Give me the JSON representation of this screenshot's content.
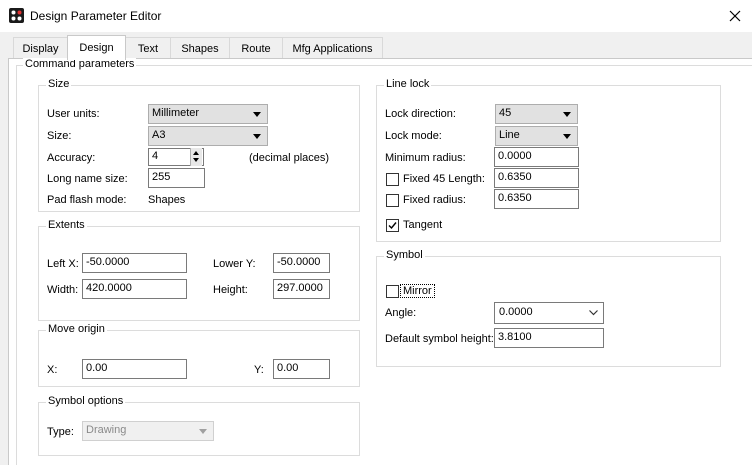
{
  "window": {
    "title": "Design Parameter Editor"
  },
  "tabs": [
    "Display",
    "Design",
    "Text",
    "Shapes",
    "Route",
    "Mfg Applications"
  ],
  "active_tab": "Design",
  "command_parameters": {
    "label": "Command parameters",
    "size": {
      "label": "Size",
      "user_units_label": "User units:",
      "user_units_value": "Millimeter",
      "size_label": "Size:",
      "size_value": "A3",
      "accuracy_label": "Accuracy:",
      "accuracy_value": "4",
      "accuracy_suffix": "(decimal places)",
      "long_name_label": "Long name size:",
      "long_name_value": "255",
      "pad_flash_label": "Pad flash mode:",
      "pad_flash_value": "Shapes"
    },
    "extents": {
      "label": "Extents",
      "left_x_label": "Left X:",
      "left_x_value": "-50.0000",
      "lower_y_label": "Lower Y:",
      "lower_y_value": "-50.0000",
      "width_label": "Width:",
      "width_value": "420.0000",
      "height_label": "Height:",
      "height_value": "297.0000"
    },
    "move_origin": {
      "label": "Move origin",
      "x_label": "X:",
      "x_value": "0.00",
      "y_label": "Y:",
      "y_value": "0.00"
    },
    "symbol_options": {
      "label": "Symbol options",
      "type_label": "Type:",
      "type_value": "Drawing"
    },
    "line_lock": {
      "label": "Line lock",
      "lock_direction_label": "Lock direction:",
      "lock_direction_value": "45",
      "lock_mode_label": "Lock mode:",
      "lock_mode_value": "Line",
      "min_radius_label": "Minimum radius:",
      "min_radius_value": "0.0000",
      "fixed45_label": "Fixed 45 Length:",
      "fixed45_value": "0.6350",
      "fixed45_checked": false,
      "fixed_radius_label": "Fixed radius:",
      "fixed_radius_value": "0.6350",
      "fixed_radius_checked": false,
      "tangent_label": "Tangent",
      "tangent_checked": true
    },
    "symbol": {
      "label": "Symbol",
      "mirror_label": "Mirror",
      "mirror_checked": false,
      "angle_label": "Angle:",
      "angle_value": "0.0000",
      "default_height_label": "Default symbol height:",
      "default_height_value": "3.8100"
    }
  }
}
